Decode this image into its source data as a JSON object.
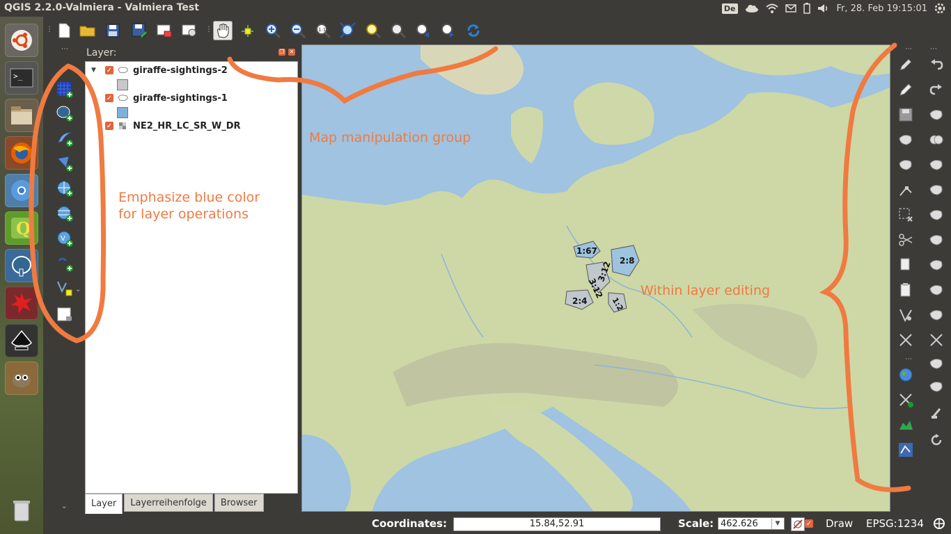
{
  "window": {
    "title": "QGIS 2.2.0-Valmiera - Valmiera Test"
  },
  "tray": {
    "keyboard": "De",
    "datetime": "Fr, 28. Feb 19:15:01"
  },
  "launcher": {
    "items": [
      "ubuntu-dash",
      "terminal",
      "files",
      "firefox",
      "chromium",
      "qgis",
      "postgresql",
      "crash-reporter",
      "inkscape",
      "gimp",
      "trash"
    ]
  },
  "toolbar": {
    "tools": [
      "new-project",
      "open-project",
      "save-project",
      "save-as",
      "print-composer",
      "composer-manager",
      "pan",
      "pan-to-selection",
      "zoom-in",
      "zoom-out",
      "zoom-actual",
      "zoom-full",
      "zoom-to-selection",
      "zoom-to-layer",
      "zoom-last",
      "zoom-next",
      "refresh"
    ]
  },
  "panel": {
    "title": "Layer:",
    "layers": [
      {
        "name": "giraffe-sightings-2",
        "checked": true,
        "swatch": "#c8c8c8"
      },
      {
        "name": "giraffe-sightings-1",
        "checked": true,
        "swatch": "#7fb0d8"
      },
      {
        "name": "NE2_HR_LC_SR_W_DR",
        "checked": true
      }
    ],
    "tabs": [
      "Layer",
      "Layerreihenfolge",
      "Browser"
    ]
  },
  "map": {
    "labels": [
      "1:67",
      "2:8",
      "3:12",
      "3:12",
      "2:4",
      "1:2"
    ]
  },
  "annotations": {
    "layer_ops": "Emphasize blue color",
    "layer_ops_2": "for layer operations",
    "map_group": "Map manipulation group",
    "editing": "Within layer editing"
  },
  "status": {
    "coordinates_label": "Coordinates:",
    "coordinates_value": "15.84,52.91",
    "scale_label": "Scale:",
    "scale_value": "462.626",
    "render_label": "Draw",
    "crs": "EPSG:1234"
  },
  "colors": {
    "accent": "#e0653c",
    "annotation": "#f07a40",
    "water": "#9fc3e0",
    "land": "#c7d49e"
  }
}
